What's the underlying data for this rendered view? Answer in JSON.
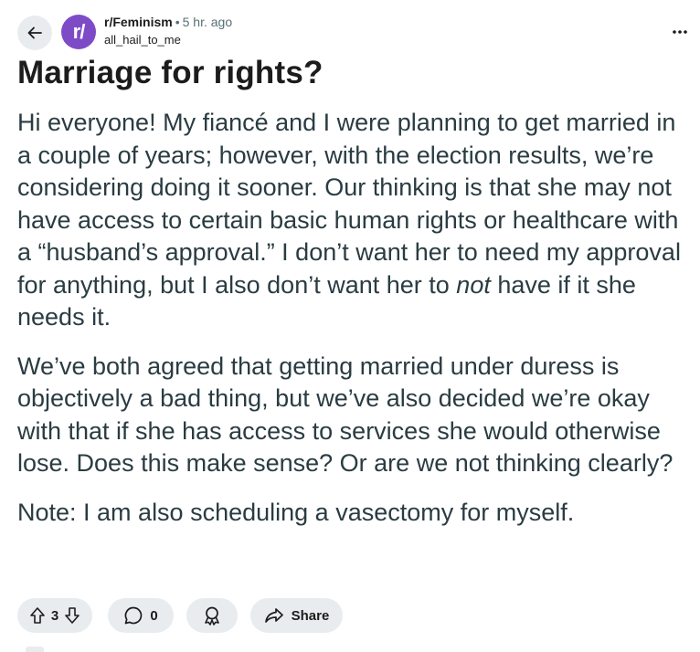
{
  "header": {
    "avatar_text": "r/",
    "subreddit": "r/Feminism",
    "separator": "•",
    "time_ago": "5 hr. ago",
    "username": "all_hail_to_me",
    "icons": {
      "back": "arrow-left-icon",
      "more": "more-horizontal-icon"
    }
  },
  "post": {
    "title": "Marriage for rights?",
    "paragraph1_a": "Hi everyone! My fiancé and I were planning to get married in a couple of years; however, with the election results, we’re considering doing it sooner. Our thinking is that she may not have access to certain basic human rights or healthcare with a “husband’s approval.” I don’t want her to need my approval for anything, but I also don’t want her to ",
    "paragraph1_em": "not",
    "paragraph1_b": " have if it she needs it.",
    "paragraph2": "We’ve both agreed that getting married under duress is objectively a bad thing, but we’ve also decided we’re okay with that if she has access to services she would otherwise lose. Does this make sense? Or are we not thinking clearly?",
    "paragraph3": "Note: I am also scheduling a vasectomy for myself."
  },
  "actions": {
    "vote_count": "3",
    "comment_count": "0",
    "share_label": "Share",
    "icons": {
      "upvote": "upvote-arrow-icon",
      "downvote": "downvote-arrow-icon",
      "comment": "comment-bubble-icon",
      "award": "award-icon",
      "share": "share-arrow-icon"
    }
  },
  "colors": {
    "avatar_bg": "#7e4bc7",
    "pill_bg": "#e9ecee",
    "body_text": "#2a3c42",
    "meta_text": "#576f76"
  }
}
